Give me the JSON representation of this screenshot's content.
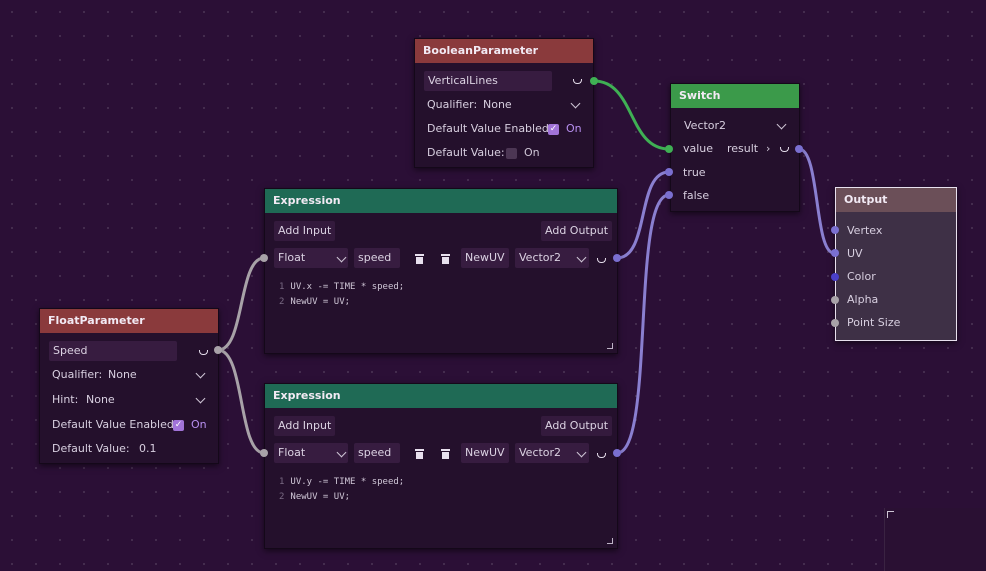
{
  "colors": {
    "background": "#2b0f36",
    "title_red": "#8a3a3c",
    "title_green": "#3b9a4a",
    "title_teal": "#1f6a55",
    "wire_green": "#3fb054",
    "wire_grey": "#a8a2a8",
    "wire_purple": "#8a7fd0",
    "check_purple": "#a173d8"
  },
  "boolean_node": {
    "title": "BooleanParameter",
    "name_value": "VerticalLines",
    "qualifier_label": "Qualifier:",
    "qualifier_value": "None",
    "default_enabled_label": "Default Value Enabled:",
    "default_enabled_state": "On",
    "default_value_label": "Default Value:",
    "default_value_state": "On"
  },
  "switch_node": {
    "title": "Switch",
    "type_value": "Vector2",
    "port_value": "value",
    "port_result": "result",
    "port_true": "true",
    "port_false": "false"
  },
  "output_node": {
    "title": "Output",
    "ports": [
      "Vertex",
      "UV",
      "Color",
      "Alpha",
      "Point Size"
    ]
  },
  "float_node": {
    "title": "FloatParameter",
    "name_value": "Speed",
    "qualifier_label": "Qualifier:",
    "qualifier_value": "None",
    "hint_label": "Hint:",
    "hint_value": "None",
    "default_enabled_label": "Default Value Enabled:",
    "default_enabled_state": "On",
    "default_value_label": "Default Value:",
    "default_value": "0.1"
  },
  "expression_1": {
    "title": "Expression",
    "add_input": "Add Input",
    "add_output": "Add Output",
    "input_type": "Float",
    "input_name": "speed",
    "output_name": "NewUV",
    "output_type": "Vector2",
    "code_lines": [
      {
        "num": "1",
        "text": "UV.x -= TIME * speed;"
      },
      {
        "num": "2",
        "text": "NewUV = UV;"
      }
    ]
  },
  "expression_2": {
    "title": "Expression",
    "add_input": "Add Input",
    "add_output": "Add Output",
    "input_type": "Float",
    "input_name": "speed",
    "output_name": "NewUV",
    "output_type": "Vector2",
    "code_lines": [
      {
        "num": "1",
        "text": "UV.y -= TIME * speed;"
      },
      {
        "num": "2",
        "text": "NewUV = UV;"
      }
    ]
  }
}
